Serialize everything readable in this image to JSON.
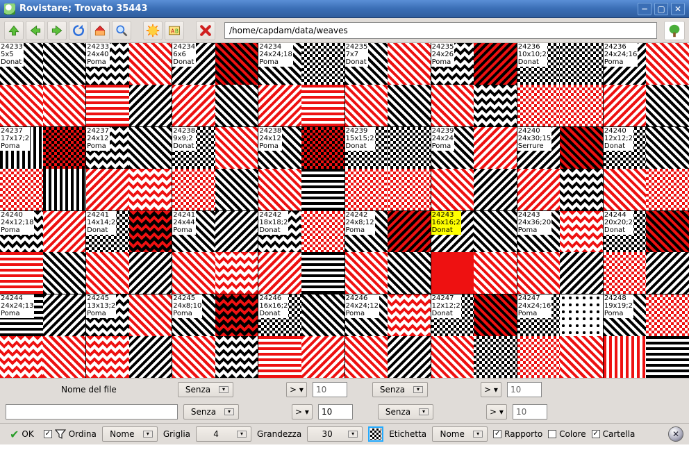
{
  "window": {
    "title": "Rovistare; Trovato 35443"
  },
  "toolbar": {
    "path": "/home/capdam/data/weaves"
  },
  "grid": [
    {
      "id": "24233",
      "dim": "5x5",
      "src": "Donat",
      "sel": false,
      "v": 0
    },
    {
      "id": "24233",
      "dim": "24x40",
      "src": "Poma",
      "sel": false,
      "v": 1
    },
    {
      "id": "24234",
      "dim": "6x6",
      "src": "Donat",
      "sel": false,
      "v": 2
    },
    {
      "id": "24234",
      "dim": "24x24;18",
      "src": "Poma",
      "sel": false,
      "v": 3
    },
    {
      "id": "24235",
      "dim": "7x7",
      "src": "Donat",
      "sel": false,
      "v": 4
    },
    {
      "id": "24235",
      "dim": "24x26",
      "src": "Poma",
      "sel": false,
      "v": 5
    },
    {
      "id": "24236",
      "dim": "10x10;2",
      "src": "Donat",
      "sel": false,
      "v": 6
    },
    {
      "id": "24236",
      "dim": "24x24;16",
      "src": "Poma",
      "sel": false,
      "v": 7
    },
    {
      "id": "24237",
      "dim": "17x17;2",
      "src": "Poma",
      "sel": false,
      "v": 8
    },
    {
      "id": "24237",
      "dim": "24x12",
      "src": "Poma",
      "sel": false,
      "v": 9
    },
    {
      "id": "24238",
      "dim": "9x9;2",
      "src": "Donat",
      "sel": false,
      "v": 10
    },
    {
      "id": "24238",
      "dim": "24x12",
      "src": "Poma",
      "sel": false,
      "v": 11
    },
    {
      "id": "24239",
      "dim": "15x15;2",
      "src": "Donat",
      "sel": false,
      "v": 12
    },
    {
      "id": "24239",
      "dim": "24x24",
      "src": "Poma",
      "sel": false,
      "v": 13
    },
    {
      "id": "24240",
      "dim": "24x30;15",
      "src": "Serrure",
      "sel": false,
      "v": 14
    },
    {
      "id": "24240",
      "dim": "12x12;2",
      "src": "Donat",
      "sel": false,
      "v": 15
    },
    {
      "id": "24240",
      "dim": "24x12;18",
      "src": "Poma",
      "sel": false,
      "v": 16
    },
    {
      "id": "24241",
      "dim": "14x14;2",
      "src": "Donat",
      "sel": false,
      "v": 17
    },
    {
      "id": "24241",
      "dim": "24x44",
      "src": "Poma",
      "sel": false,
      "v": 18
    },
    {
      "id": "24242",
      "dim": "18x18;2",
      "src": "Donat",
      "sel": false,
      "v": 19
    },
    {
      "id": "24242",
      "dim": "24x8;12",
      "src": "Poma",
      "sel": false,
      "v": 20
    },
    {
      "id": "24243",
      "dim": "16x16;2",
      "src": "Donat",
      "sel": true,
      "v": 21
    },
    {
      "id": "24243",
      "dim": "24x36;20",
      "src": "Poma",
      "sel": false,
      "v": 22
    },
    {
      "id": "24244",
      "dim": "20x20;2",
      "src": "Donat",
      "sel": false,
      "v": 23
    },
    {
      "id": "24244",
      "dim": "24x24;13",
      "src": "Poma",
      "sel": false,
      "v": 24
    },
    {
      "id": "24245",
      "dim": "13x13;2",
      "src": "Poma",
      "sel": false,
      "v": 25
    },
    {
      "id": "24245",
      "dim": "24x8;10",
      "src": "Poma",
      "sel": false,
      "v": 26
    },
    {
      "id": "24246",
      "dim": "16x16;2",
      "src": "Donat",
      "sel": false,
      "v": 27
    },
    {
      "id": "24246",
      "dim": "24x24;12",
      "src": "Poma",
      "sel": false,
      "v": 28
    },
    {
      "id": "24247",
      "dim": "12x12;2",
      "src": "Donat",
      "sel": false,
      "v": 29
    },
    {
      "id": "24247",
      "dim": "24x24;16",
      "src": "Poma",
      "sel": false,
      "v": 30
    },
    {
      "id": "24248",
      "dim": "19x19;2",
      "src": "Poma",
      "sel": false,
      "v": 31
    }
  ],
  "filters": {
    "filename_label": "Nome del file",
    "senza": "Senza",
    "gt": ">",
    "eq": "=",
    "num_a": "10",
    "num_b": "10",
    "num_c": "10",
    "num_d": "10"
  },
  "footer": {
    "ok": "OK",
    "ordina": "Ordina",
    "nome": "Nome",
    "griglia": "Griglia",
    "griglia_val": "4",
    "grandezza": "Grandezza",
    "grandezza_val": "30",
    "etichetta": "Etichetta",
    "rapporto": "Rapporto",
    "colore": "Colore",
    "cartella": "Cartella"
  }
}
